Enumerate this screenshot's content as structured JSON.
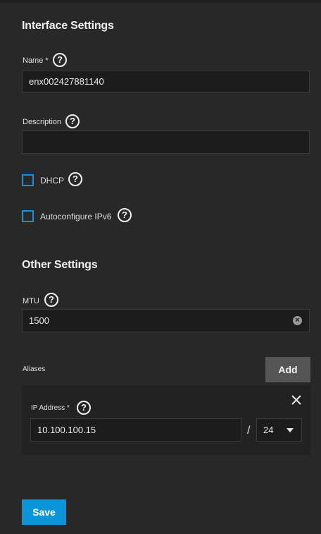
{
  "interface_settings": {
    "title": "Interface Settings",
    "name": {
      "label": "Name",
      "required_mark": "*",
      "value": "enx002427881140"
    },
    "description": {
      "label": "Description",
      "value": ""
    },
    "dhcp": {
      "label": "DHCP",
      "checked": false
    },
    "autoconfigure_ipv6": {
      "label": "Autoconfigure IPv6",
      "checked": false
    }
  },
  "other_settings": {
    "title": "Other Settings",
    "mtu": {
      "label": "MTU",
      "value": "1500"
    }
  },
  "aliases": {
    "label": "Aliases",
    "add_label": "Add",
    "items": [
      {
        "ip_label": "IP Address",
        "required_mark": "*",
        "ip_value": "10.100.100.15",
        "separator": "/",
        "netmask": "24"
      }
    ]
  },
  "actions": {
    "save_label": "Save"
  },
  "icons": {
    "help": "help-circle-icon",
    "clear": "clear-circle-icon",
    "close": "close-icon",
    "dropdown": "chevron-down-icon"
  },
  "colors": {
    "background": "#282828",
    "input_background": "#1c1c1c",
    "accent": "#0a95d8",
    "checkbox_border": "#1d8fd0",
    "add_button": "#555555"
  }
}
